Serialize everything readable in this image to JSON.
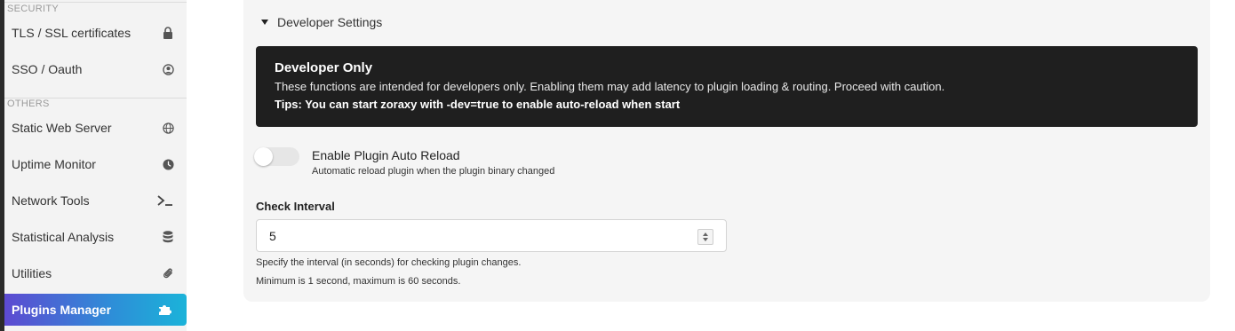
{
  "sidebar": {
    "security_label": "SECURITY",
    "others_label": "OTHERS",
    "items": [
      {
        "label": "TLS / SSL certificates",
        "icon": "lock-icon"
      },
      {
        "label": "SSO / Oauth",
        "icon": "user-circle-icon"
      },
      {
        "label": "Static Web Server",
        "icon": "globe-icon"
      },
      {
        "label": "Uptime Monitor",
        "icon": "clock-icon"
      },
      {
        "label": "Network Tools",
        "icon": "terminal-icon"
      },
      {
        "label": "Statistical Analysis",
        "icon": "database-icon"
      },
      {
        "label": "Utilities",
        "icon": "paperclip-icon"
      },
      {
        "label": "Plugins Manager",
        "icon": "puzzle-icon"
      }
    ]
  },
  "developer": {
    "header": "Developer Settings",
    "notice_title": "Developer Only",
    "notice_desc": "These functions are intended for developers only. Enabling them may add latency to plugin loading & routing. Proceed with caution.",
    "notice_tips": "Tips: You can start zoraxy with -dev=true to enable auto-reload when start",
    "toggle_label": "Enable Plugin Auto Reload",
    "toggle_sub": "Automatic reload plugin when the plugin binary changed",
    "toggle_on": false,
    "interval_label": "Check Interval",
    "interval_value": "5",
    "help_1": "Specify the interval (in seconds) for checking plugin changes.",
    "help_2": "Minimum is 1 second, maximum is 60 seconds."
  },
  "colors": {
    "active_gradient_start": "#5d4ad1",
    "active_gradient_end": "#1bb3d9",
    "notice_bg": "#1f1f1f"
  }
}
